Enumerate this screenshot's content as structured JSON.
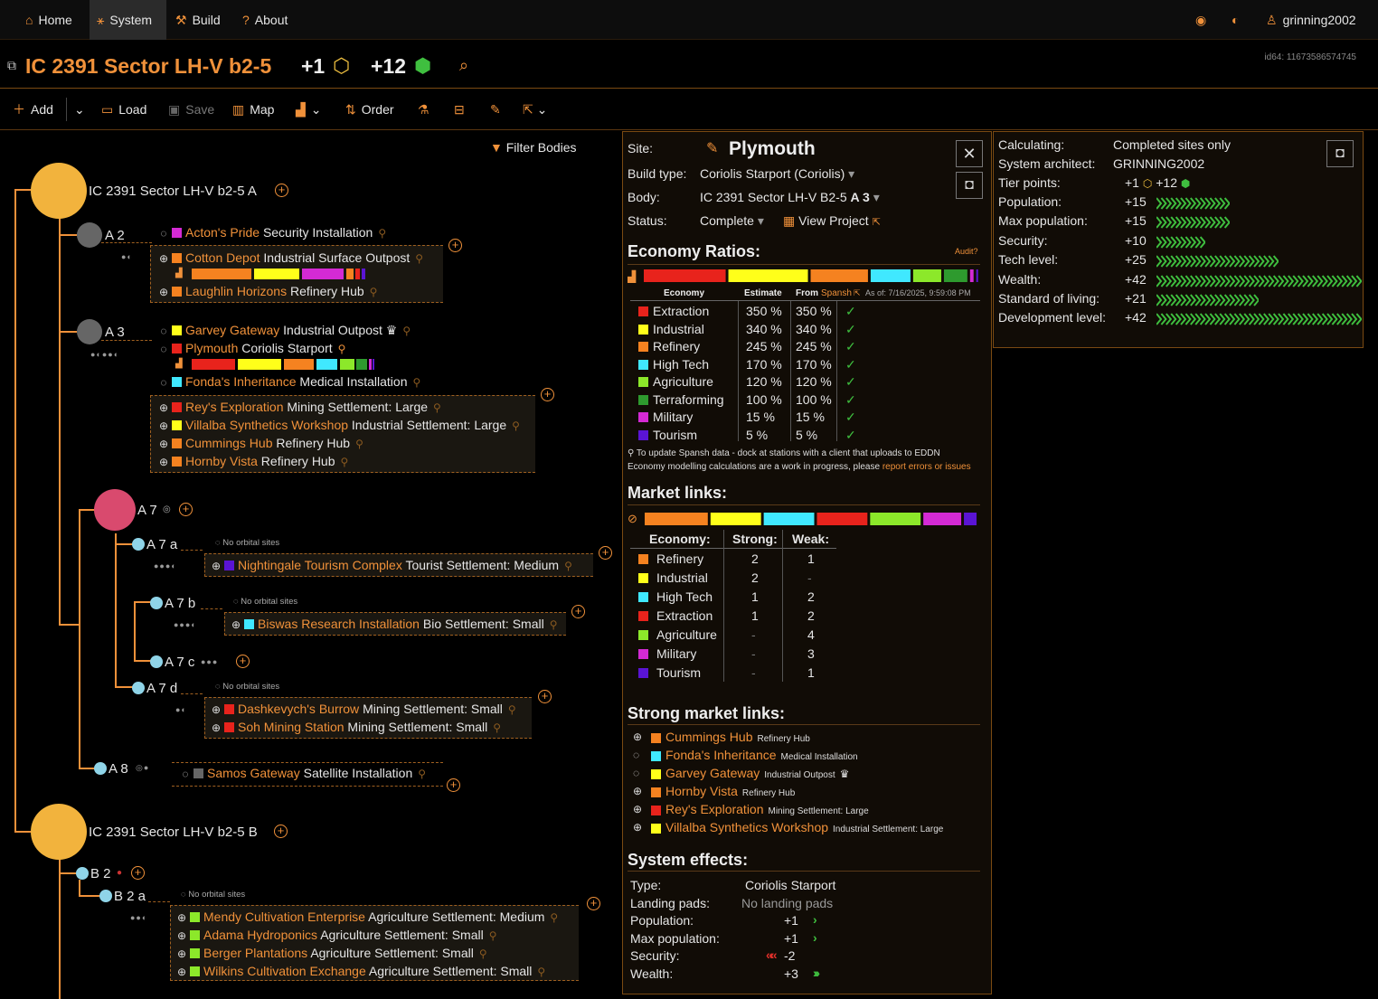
{
  "nav": {
    "home": "Home",
    "system": "System",
    "build": "Build",
    "about": "About",
    "user": "grinning2002"
  },
  "title": {
    "name": "IC 2391 Sector LH-V b2-5",
    "tp1": "+1",
    "tp2": "+12",
    "id64": "id64: 11673586574745"
  },
  "toolbar": {
    "add": "Add",
    "load": "Load",
    "save": "Save",
    "map": "Map",
    "order": "Order",
    "filter": "Filter Bodies"
  },
  "tree": {
    "starA": "IC 2391 Sector LH-V b2-5 A",
    "starB": "IC 2391 Sector LH-V b2-5 B",
    "A2": "A 2",
    "A3": "A 3",
    "A7": "A 7",
    "A7a": "A 7 a",
    "A7b": "A 7 b",
    "A7c": "A 7 c",
    "A7d": "A 7 d",
    "A8": "A 8",
    "B2": "B 2",
    "B2a": "B 2 a",
    "noOrbital": "No orbital sites",
    "sites": {
      "a2_1": {
        "name": "Acton's Pride",
        "type": "Security Installation"
      },
      "a2_2": {
        "name": "Cotton Depot",
        "type": "Industrial Surface Outpost"
      },
      "a2_3": {
        "name": "Laughlin Horizons",
        "type": "Refinery Hub"
      },
      "a3_1": {
        "name": "Garvey Gateway",
        "type": "Industrial Outpost"
      },
      "a3_2": {
        "name": "Plymouth",
        "type": "Coriolis Starport"
      },
      "a3_3": {
        "name": "Fonda's Inheritance",
        "type": "Medical Installation"
      },
      "a3_4": {
        "name": "Rey's Exploration",
        "type": "Mining Settlement: Large"
      },
      "a3_5": {
        "name": "Villalba Synthetics Workshop",
        "type": "Industrial Settlement: Large"
      },
      "a3_6": {
        "name": "Cummings Hub",
        "type": "Refinery Hub"
      },
      "a3_7": {
        "name": "Hornby Vista",
        "type": "Refinery Hub"
      },
      "a7a_1": {
        "name": "Nightingale Tourism Complex",
        "type": "Tourist Settlement: Medium"
      },
      "a7b_1": {
        "name": "Biswas Research Installation",
        "type": "Bio Settlement: Small"
      },
      "a7d_1": {
        "name": "Dashkevych's Burrow",
        "type": "Mining Settlement: Small"
      },
      "a7d_2": {
        "name": "Soh Mining Station",
        "type": "Mining Settlement: Small"
      },
      "a8_1": {
        "name": "Samos Gateway",
        "type": "Satellite Installation"
      },
      "b2a_1": {
        "name": "Mendy Cultivation Enterprise",
        "type": "Agriculture Settlement: Medium"
      },
      "b2a_2": {
        "name": "Adama Hydroponics",
        "type": "Agriculture Settlement: Small"
      },
      "b2a_3": {
        "name": "Berger Plantations",
        "type": "Agriculture Settlement: Small"
      },
      "b2a_4": {
        "name": "Wilkins Cultivation Exchange",
        "type": "Agriculture Settlement: Small"
      }
    }
  },
  "site": {
    "siteLabel": "Site:",
    "siteName": "Plymouth",
    "buildTypeLabel": "Build type:",
    "buildType": "Coriolis Starport (Coriolis)",
    "bodyLabel": "Body:",
    "bodyName": "IC 2391 Sector LH-V B2-5",
    "bodyShort": "A 3",
    "statusLabel": "Status:",
    "status": "Complete",
    "viewProject": "View Project",
    "econHeader": "Economy Ratios:",
    "audit": "Audit?",
    "colEconomy": "Economy",
    "colEstimate": "Estimate",
    "colFrom": "From",
    "colSpansh": "Spansh",
    "asOf": "As of: 7/16/2025, 9:59:08 PM",
    "economies": [
      {
        "name": "Extraction",
        "color": "#e8231c",
        "est": "350 %",
        "spansh": "350 %"
      },
      {
        "name": "Industrial",
        "color": "#ffff1a",
        "est": "340 %",
        "spansh": "340 %"
      },
      {
        "name": "Refinery",
        "color": "#f58220",
        "est": "245 %",
        "spansh": "245 %"
      },
      {
        "name": "High Tech",
        "color": "#40e8ff",
        "est": "170 %",
        "spansh": "170 %"
      },
      {
        "name": "Agriculture",
        "color": "#8ce82a",
        "est": "120 %",
        "spansh": "120 %"
      },
      {
        "name": "Terraforming",
        "color": "#2e9a2e",
        "est": "100 %",
        "spansh": "100 %"
      },
      {
        "name": "Military",
        "color": "#d42ad4",
        "est": "15 %",
        "spansh": "15 %"
      },
      {
        "name": "Tourism",
        "color": "#5a14d4",
        "est": "5 %",
        "spansh": "5 %"
      }
    ],
    "note1": "To update Spansh data - dock at stations with a client that uploads to EDDN",
    "note2": "Economy modelling calculations are a work in progress, please",
    "note2link": "report errors or issues",
    "marketHeader": "Market links:",
    "colMEconomy": "Economy:",
    "colStrong": "Strong:",
    "colWeak": "Weak:",
    "markets": [
      {
        "name": "Refinery",
        "color": "#f58220",
        "strong": "2",
        "weak": "1"
      },
      {
        "name": "Industrial",
        "color": "#ffff1a",
        "strong": "2",
        "weak": "-"
      },
      {
        "name": "High Tech",
        "color": "#40e8ff",
        "strong": "1",
        "weak": "2"
      },
      {
        "name": "Extraction",
        "color": "#e8231c",
        "strong": "1",
        "weak": "2"
      },
      {
        "name": "Agriculture",
        "color": "#8ce82a",
        "strong": "-",
        "weak": "4"
      },
      {
        "name": "Military",
        "color": "#d42ad4",
        "strong": "-",
        "weak": "3"
      },
      {
        "name": "Tourism",
        "color": "#5a14d4",
        "strong": "-",
        "weak": "1"
      }
    ],
    "strongHeader": "Strong market links:",
    "strongLinks": [
      {
        "name": "Cummings Hub",
        "type": "Refinery Hub",
        "color": "#f58220"
      },
      {
        "name": "Fonda's Inheritance",
        "type": "Medical Installation",
        "color": "#40e8ff"
      },
      {
        "name": "Garvey Gateway",
        "type": "Industrial Outpost",
        "color": "#ffff1a"
      },
      {
        "name": "Hornby Vista",
        "type": "Refinery Hub",
        "color": "#f58220"
      },
      {
        "name": "Rey's Exploration",
        "type": "Mining Settlement: Large",
        "color": "#e8231c"
      },
      {
        "name": "Villalba Synthetics Workshop",
        "type": "Industrial Settlement: Large",
        "color": "#ffff1a"
      }
    ],
    "effectsHeader": "System effects:",
    "effects": [
      {
        "label": "Type:",
        "value": "Coriolis Starport"
      },
      {
        "label": "Landing pads:",
        "value": "No landing pads"
      },
      {
        "label": "Population:",
        "value": "+1"
      },
      {
        "label": "Max population:",
        "value": "+1"
      },
      {
        "label": "Security:",
        "value": "-2"
      },
      {
        "label": "Wealth:",
        "value": "+3"
      }
    ]
  },
  "summary": {
    "calcLabel": "Calculating:",
    "calc": "Completed sites only",
    "archLabel": "System architect:",
    "arch": "GRINNING2002",
    "tierLabel": "Tier points:",
    "tier1": "+1",
    "tier2": "+12",
    "rows": [
      {
        "label": "Population:",
        "value": "+15",
        "chev": 15
      },
      {
        "label": "Max population:",
        "value": "+15",
        "chev": 15
      },
      {
        "label": "Security:",
        "value": "+10",
        "chev": 10
      },
      {
        "label": "Tech level:",
        "value": "+25",
        "chev": 25
      },
      {
        "label": "Wealth:",
        "value": "+42",
        "chev": 42
      },
      {
        "label": "Standard of living:",
        "value": "+21",
        "chev": 21
      },
      {
        "label": "Development level:",
        "value": "+42",
        "chev": 42
      }
    ]
  }
}
